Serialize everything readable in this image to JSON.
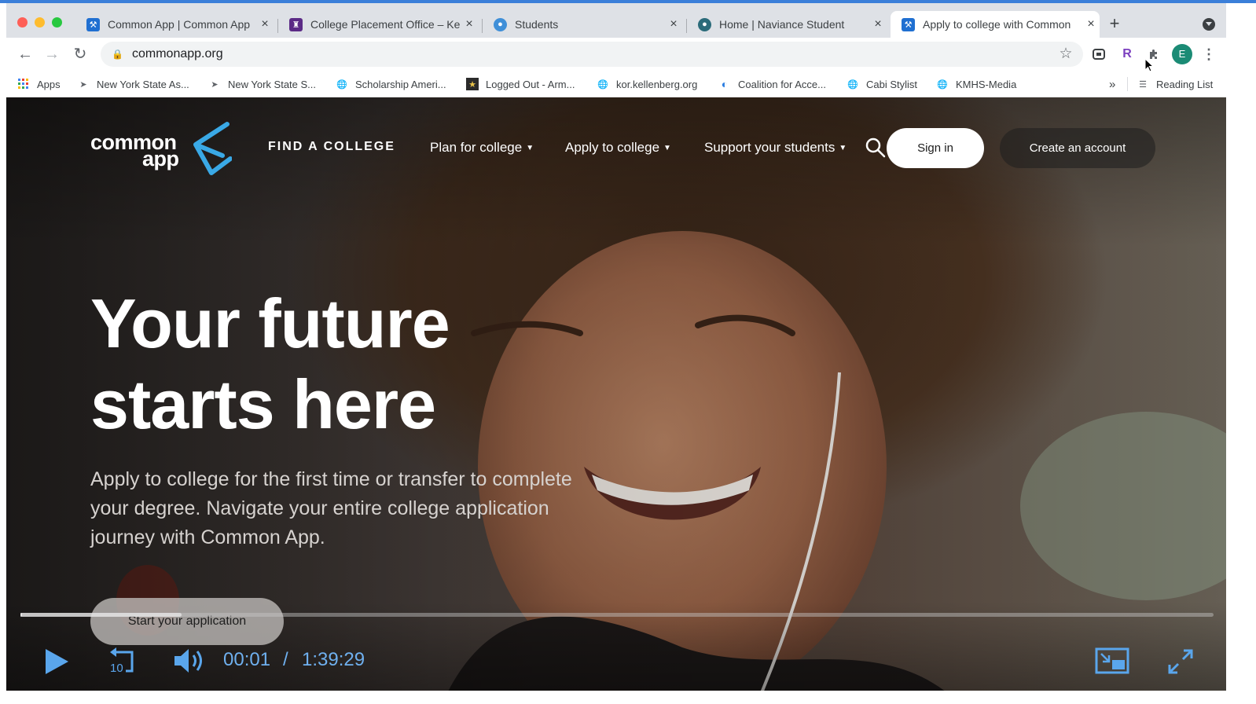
{
  "browser": {
    "tabs": [
      {
        "title": "Common App | Common App",
        "active": false
      },
      {
        "title": "College Placement Office – Kel",
        "active": false
      },
      {
        "title": "Students",
        "active": false
      },
      {
        "title": "Home | Naviance Student",
        "active": false
      },
      {
        "title": "Apply to college with Common",
        "active": true
      }
    ],
    "url": "commonapp.org",
    "bookmarks": [
      {
        "label": "Apps",
        "icon": "apps-grid-icon"
      },
      {
        "label": "New York State As...",
        "icon": "bird-icon"
      },
      {
        "label": "New York State S...",
        "icon": "bird-icon"
      },
      {
        "label": "Scholarship Ameri...",
        "icon": "globe-icon"
      },
      {
        "label": "Logged Out - Arm...",
        "icon": "army-star-icon"
      },
      {
        "label": "kor.kellenberg.org",
        "icon": "globe-icon"
      },
      {
        "label": "Coalition for Acce...",
        "icon": "coalition-icon"
      },
      {
        "label": "Cabi Stylist",
        "icon": "globe-icon"
      },
      {
        "label": "KMHS-Media",
        "icon": "globe-icon"
      }
    ],
    "bookmarks_overflow": "»",
    "reading_list": "Reading List",
    "profile_initial": "E",
    "extension_r": "R"
  },
  "site": {
    "logo_line1": "common",
    "logo_line2": "app",
    "nav": {
      "find": "FIND A COLLEGE",
      "plan": "Plan for college",
      "apply": "Apply to college",
      "support": "Support your students"
    },
    "sign_in": "Sign in",
    "create_account": "Create an account",
    "headline_line1": "Your future",
    "headline_line2": "starts here",
    "subtext": "Apply to college for the first time or transfer to complete your degree. Navigate your entire college application journey with Common App.",
    "start_button": "Start your application"
  },
  "video": {
    "current_time": "00:01",
    "separator": "/",
    "total_time": "1:39:29",
    "progress_fraction": 0.0002,
    "buffer_fraction": 0.135,
    "rewind_seconds": "10"
  },
  "colors": {
    "brand_blue": "#3aa9e6",
    "time_text": "#6fb0ef",
    "chrome_tabbar": "#dee1e6"
  }
}
